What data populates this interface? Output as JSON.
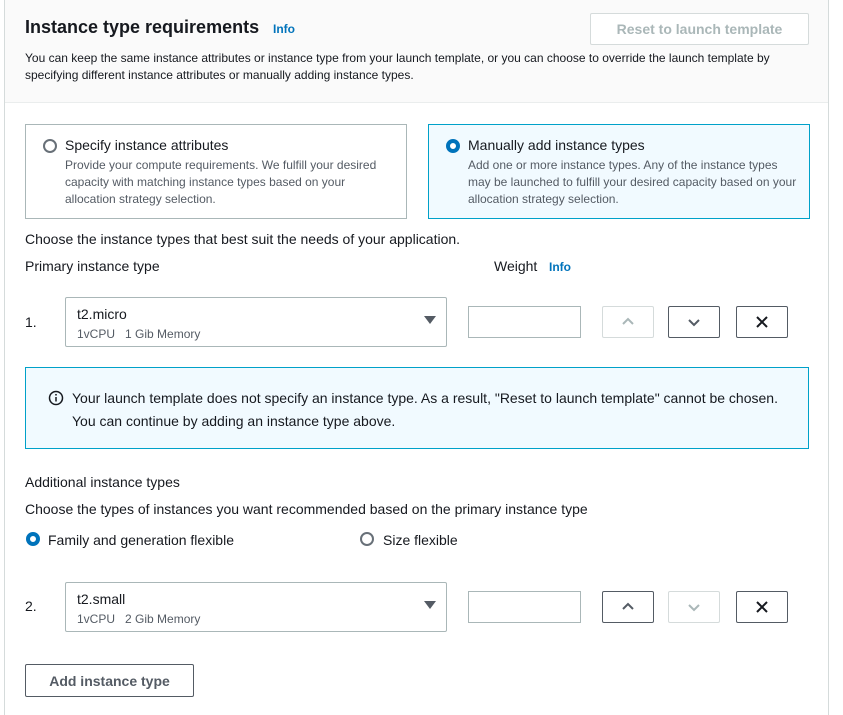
{
  "header": {
    "title": "Instance type requirements",
    "info": "Info",
    "reset_label": "Reset to launch template",
    "description": "You can keep the same instance attributes or instance type from your launch template, or you can choose to override the launch template by specifying different instance attributes or manually adding instance types."
  },
  "tiles": [
    {
      "label": "Specify instance attributes",
      "description": "Provide your compute requirements. We fulfill your desired capacity with matching instance types based on your allocation strategy selection.",
      "selected": false
    },
    {
      "label": "Manually add instance types",
      "description": "Add one or more instance types. Any of the instance types may be launched to fulfill your desired capacity based on your allocation strategy selection.",
      "selected": true
    }
  ],
  "choose_text": "Choose the instance types that best suit the needs of your application.",
  "primary": {
    "label": "Primary instance type",
    "weight_label": "Weight",
    "weight_info": "Info",
    "row": {
      "num": "1.",
      "value": "t2.micro",
      "vcpu": "1vCPU",
      "memory": "1 Gib Memory",
      "weight": ""
    }
  },
  "alert": {
    "text": "Your launch template does not specify an instance type. As a result, \"Reset to launch template\" cannot be chosen. You can continue by adding an instance type above."
  },
  "additional": {
    "label": "Additional instance types",
    "description": "Choose the types of instances you want recommended based on the primary instance type",
    "options": [
      {
        "label": "Family and generation flexible",
        "selected": true
      },
      {
        "label": "Size flexible",
        "selected": false
      }
    ],
    "row": {
      "num": "2.",
      "value": "t2.small",
      "vcpu": "1vCPU",
      "memory": "2 Gib Memory",
      "weight": ""
    }
  },
  "add_button": "Add instance type",
  "icons": {
    "up": "chevron-up-icon",
    "down": "chevron-down-icon",
    "remove": "close-icon",
    "info": "info-circle-icon",
    "caret": "caret-down-icon"
  },
  "colors": {
    "accent": "#0073bb",
    "selected_border": "#00a1c9",
    "selected_bg": "#f1faff"
  }
}
